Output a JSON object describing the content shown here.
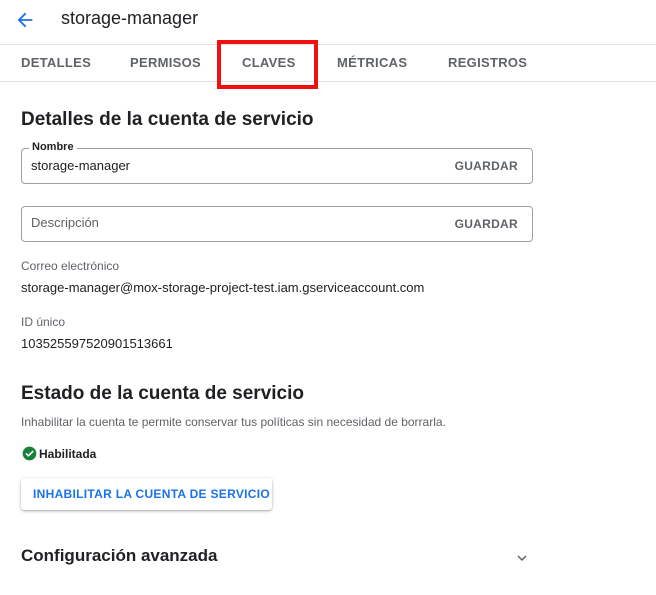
{
  "header": {
    "title": "storage-manager",
    "back_icon": "arrow-back-icon"
  },
  "tabs": [
    {
      "label": "DETALLES"
    },
    {
      "label": "PERMISOS"
    },
    {
      "label": "CLAVES"
    },
    {
      "label": "MÉTRICAS"
    },
    {
      "label": "REGISTROS"
    }
  ],
  "details": {
    "heading": "Detalles de la cuenta de servicio",
    "name_field": {
      "label": "Nombre",
      "value": "storage-manager",
      "action": "GUARDAR"
    },
    "description_field": {
      "placeholder": "Descripción",
      "value": "",
      "action": "GUARDAR"
    },
    "email": {
      "label": "Correo electrónico",
      "value": "storage-manager@mox-storage-project-test.iam.gserviceaccount.com"
    },
    "unique_id": {
      "label": "ID único",
      "value": "103525597520901513661"
    }
  },
  "status_section": {
    "heading": "Estado de la cuenta de servicio",
    "description": "Inhabilitar la cuenta te permite conservar tus políticas sin necesidad de borrarla.",
    "status_text": "Habilitada",
    "status_icon": "check-circle-icon",
    "button_label": "INHABILITAR LA CUENTA DE SERVICIO"
  },
  "advanced": {
    "heading": "Configuración avanzada",
    "icon": "chevron-down-icon"
  },
  "colors": {
    "accent": "#1a73e8",
    "success": "#188038",
    "highlight": "#f01010",
    "text_secondary": "#5f6368"
  }
}
